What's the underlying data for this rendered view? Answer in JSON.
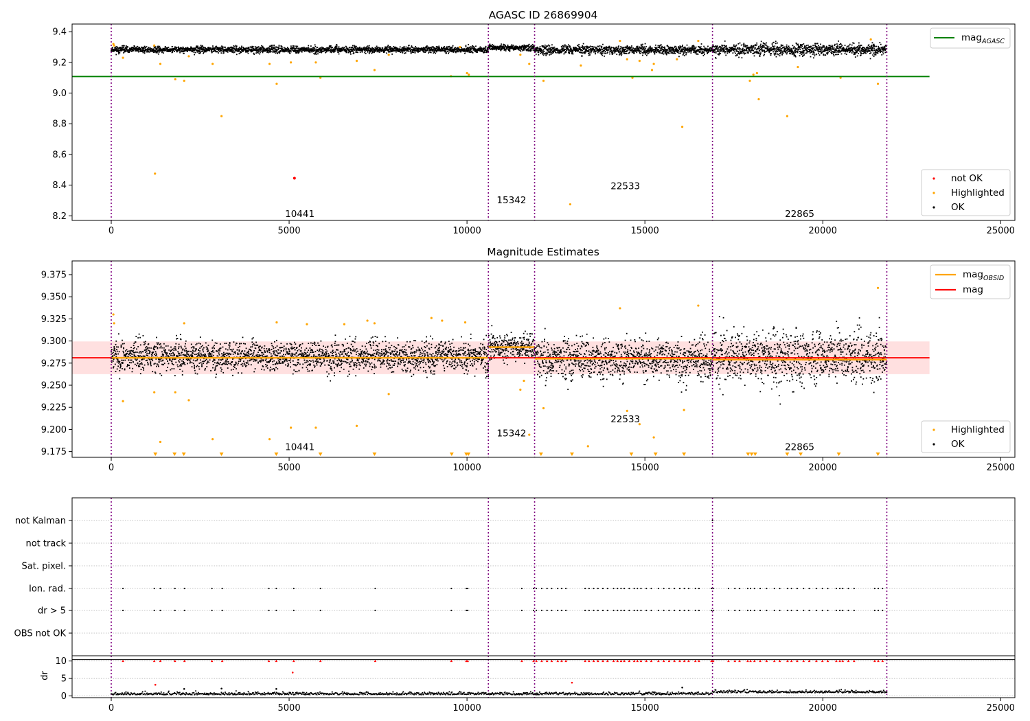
{
  "chart_data": [
    {
      "type": "scatter",
      "title": "AGASC ID 26869904",
      "xlim": [
        -1100,
        25400
      ],
      "ylim": [
        8.17,
        9.45
      ],
      "xticks": [
        0,
        5000,
        10000,
        15000,
        20000,
        25000
      ],
      "xtick_labels": [
        "0",
        "5000",
        "10000",
        "15000",
        "20000",
        "25000"
      ],
      "yticks": [
        8.2,
        8.4,
        8.6,
        8.8,
        9.0,
        9.2,
        9.4
      ],
      "ytick_labels": [
        "8.2",
        "8.4",
        "8.6",
        "8.8",
        "9.0",
        "9.2",
        "9.4"
      ],
      "legend_upper": {
        "placement": "top-right",
        "entries": [
          {
            "label": "mag",
            "sub": "AGASC",
            "color": "#008000"
          }
        ]
      },
      "legend_lower": {
        "placement": "bottom-right",
        "entries": [
          {
            "label": "not OK",
            "color": "#ff0000"
          },
          {
            "label": "Highlighted",
            "color": "#ffa500"
          },
          {
            "label": "OK",
            "color": "#000000"
          }
        ]
      },
      "mag_agasc": {
        "value": 9.108,
        "x": [
          -1100,
          23000
        ]
      },
      "obs_boundaries": [
        0,
        10600,
        11900,
        16900,
        21800
      ],
      "obs_labels": [
        {
          "text": "10441",
          "x": 5300,
          "y": 8.215
        },
        {
          "text": "15342",
          "x": 11250,
          "y": 8.305
        },
        {
          "text": "22533",
          "x": 14450,
          "y": 8.395
        },
        {
          "text": "22865",
          "x": 19350,
          "y": 8.215
        }
      ],
      "ok_band": [
        {
          "x0": 0,
          "x1": 10600,
          "center": 9.283,
          "spread": 0.022
        },
        {
          "x0": 10600,
          "x1": 11900,
          "center": 9.295,
          "spread": 0.02
        },
        {
          "x0": 11900,
          "x1": 16900,
          "center": 9.281,
          "spread": 0.03
        },
        {
          "x0": 16900,
          "x1": 21800,
          "center": 9.283,
          "spread": 0.04
        }
      ],
      "highlighted": [
        [
          60,
          9.32
        ],
        [
          80,
          9.31
        ],
        [
          330,
          9.23
        ],
        [
          1210,
          9.31
        ],
        [
          1230,
          8.475
        ],
        [
          1380,
          9.19
        ],
        [
          1800,
          9.09
        ],
        [
          2050,
          9.08
        ],
        [
          2180,
          9.24
        ],
        [
          2850,
          9.19
        ],
        [
          3100,
          8.85
        ],
        [
          4450,
          9.19
        ],
        [
          4650,
          9.06
        ],
        [
          5050,
          9.2
        ],
        [
          5750,
          9.2
        ],
        [
          5880,
          9.1
        ],
        [
          6900,
          9.21
        ],
        [
          7400,
          9.15
        ],
        [
          7800,
          9.25
        ],
        [
          9550,
          9.11
        ],
        [
          9800,
          9.3
        ],
        [
          10000,
          9.13
        ],
        [
          10050,
          9.12
        ],
        [
          11500,
          9.25
        ],
        [
          11750,
          9.19
        ],
        [
          12150,
          9.08
        ],
        [
          12900,
          8.275
        ],
        [
          13200,
          9.18
        ],
        [
          14300,
          9.34
        ],
        [
          14500,
          9.22
        ],
        [
          14650,
          9.1
        ],
        [
          14850,
          9.21
        ],
        [
          15200,
          9.15
        ],
        [
          15250,
          9.19
        ],
        [
          15900,
          9.22
        ],
        [
          16050,
          8.78
        ],
        [
          16500,
          9.34
        ],
        [
          17950,
          9.08
        ],
        [
          18050,
          9.12
        ],
        [
          18150,
          9.13
        ],
        [
          18200,
          8.96
        ],
        [
          19000,
          8.85
        ],
        [
          19300,
          9.17
        ],
        [
          20500,
          9.1
        ],
        [
          21350,
          9.35
        ],
        [
          21550,
          9.06
        ]
      ],
      "not_ok": [
        [
          5150,
          8.445
        ]
      ]
    },
    {
      "type": "scatter",
      "title": "Magnitude Estimates",
      "xlim": [
        -1100,
        25400
      ],
      "ylim": [
        9.1685,
        9.3905
      ],
      "xticks": [
        0,
        5000,
        10000,
        15000,
        20000,
        25000
      ],
      "xtick_labels": [
        "0",
        "5000",
        "10000",
        "15000",
        "20000",
        "25000"
      ],
      "yticks": [
        9.175,
        9.2,
        9.225,
        9.25,
        9.275,
        9.3,
        9.325,
        9.35,
        9.375
      ],
      "ytick_labels": [
        "9.175",
        "9.200",
        "9.225",
        "9.250",
        "9.275",
        "9.300",
        "9.325",
        "9.350",
        "9.375"
      ],
      "legend_upper": {
        "placement": "top-right",
        "entries": [
          {
            "label": "mag",
            "sub": "OBSID",
            "color": "#ffa500"
          },
          {
            "label": "mag",
            "color": "#ff0000"
          }
        ]
      },
      "legend_lower": {
        "placement": "bottom-right",
        "entries": [
          {
            "label": "Highlighted",
            "color": "#ffa500"
          },
          {
            "label": "OK",
            "color": "#000000"
          }
        ]
      },
      "mag": {
        "value": 9.281,
        "band": [
          9.2625,
          9.2995
        ],
        "x": [
          -1100,
          23000
        ]
      },
      "mag_obsid": [
        {
          "x0": 0,
          "x1": 10600,
          "value": 9.281
        },
        {
          "x0": 10600,
          "x1": 11900,
          "value": 9.293
        },
        {
          "x0": 11900,
          "x1": 16900,
          "value": 9.28
        },
        {
          "x0": 16900,
          "x1": 21800,
          "value": 9.279
        }
      ],
      "obs_boundaries": [
        0,
        10600,
        11900,
        16900,
        21800
      ],
      "obs_labels": [
        {
          "text": "10441",
          "x": 5300,
          "y": 9.1805
        },
        {
          "text": "15342",
          "x": 11250,
          "y": 9.196
        },
        {
          "text": "22533",
          "x": 14450,
          "y": 9.212
        },
        {
          "text": "22865",
          "x": 19350,
          "y": 9.1805
        }
      ],
      "ok_band": [
        {
          "x0": 0,
          "x1": 10600,
          "center": 9.283,
          "spread": 0.018
        },
        {
          "x0": 10600,
          "x1": 11900,
          "center": 9.294,
          "spread": 0.016
        },
        {
          "x0": 11900,
          "x1": 16900,
          "center": 9.279,
          "spread": 0.024
        },
        {
          "x0": 16900,
          "x1": 21800,
          "center": 9.282,
          "spread": 0.032
        }
      ],
      "highlighted": [
        [
          60,
          9.33
        ],
        [
          80,
          9.32
        ],
        [
          330,
          9.232
        ],
        [
          1210,
          9.242
        ],
        [
          1380,
          9.186
        ],
        [
          1800,
          9.242
        ],
        [
          2050,
          9.32
        ],
        [
          2180,
          9.233
        ],
        [
          2850,
          9.189
        ],
        [
          4450,
          9.189
        ],
        [
          4650,
          9.321
        ],
        [
          5050,
          9.202
        ],
        [
          5500,
          9.319
        ],
        [
          5750,
          9.202
        ],
        [
          6550,
          9.319
        ],
        [
          6900,
          9.204
        ],
        [
          7200,
          9.323
        ],
        [
          7400,
          9.32
        ],
        [
          7800,
          9.24
        ],
        [
          9000,
          9.326
        ],
        [
          9300,
          9.323
        ],
        [
          9950,
          9.321
        ],
        [
          11500,
          9.245
        ],
        [
          11600,
          9.255
        ],
        [
          11750,
          9.194
        ],
        [
          12150,
          9.224
        ],
        [
          13400,
          9.181
        ],
        [
          14300,
          9.337
        ],
        [
          14500,
          9.221
        ],
        [
          14850,
          9.206
        ],
        [
          15250,
          9.191
        ],
        [
          16100,
          9.222
        ],
        [
          16500,
          9.34
        ],
        [
          21550,
          9.36
        ]
      ],
      "below_markers": [
        1240,
        1780,
        2040,
        3100,
        4640,
        5880,
        7400,
        9570,
        9980,
        10040,
        12080,
        12950,
        14620,
        15300,
        16100,
        17900,
        18000,
        18100,
        19000,
        19380,
        20450,
        21550
      ]
    },
    {
      "type": "scatter",
      "flags_panel": {
        "ylabels": [
          "not Kalman",
          "not track",
          "Sat. pixel.",
          "Ion. rad.",
          "dr > 5",
          "OBS not OK"
        ],
        "obs_boundaries": [
          0,
          10600,
          11900,
          16900,
          21800
        ],
        "not_kalman": [
          16900
        ],
        "ion_rad": [
          330,
          1210,
          1380,
          1790,
          2060,
          2830,
          3120,
          4430,
          4640,
          5130,
          5880,
          7420,
          9560,
          9980,
          10020,
          11540,
          11870,
          11950,
          12100,
          12250,
          12380,
          12550,
          12660,
          12780,
          13320,
          13430,
          13560,
          13680,
          13820,
          13950,
          14120,
          14230,
          14330,
          14420,
          14560,
          14700,
          14790,
          14890,
          15040,
          15180,
          15380,
          15530,
          15680,
          15830,
          15980,
          16110,
          16230,
          16420,
          16520,
          16870,
          16920,
          17350,
          17530,
          17660,
          17890,
          17970,
          18080,
          18240,
          18420,
          18640,
          18790,
          19010,
          19120,
          19280,
          19460,
          19620,
          19820,
          19990,
          20140,
          20380,
          20480,
          20560,
          20720,
          20880,
          21460,
          21560,
          21680
        ]
      },
      "dr_panel": {
        "ylabel": "dr",
        "ylim": [
          -0.5,
          11.5
        ],
        "yticks": [
          0,
          5,
          10
        ],
        "ytick_labels": [
          "0",
          "5",
          "10"
        ],
        "xlim": [
          -1100,
          25400
        ],
        "xticks": [
          0,
          5000,
          10000,
          15000,
          20000,
          25000
        ],
        "xtick_labels": [
          "0",
          "5000",
          "10000",
          "15000",
          "20000",
          "25000"
        ],
        "cutoff_line": 10.4,
        "outliers": [
          [
            1240,
            3.2,
            "#ff0000"
          ],
          [
            5100,
            6.7,
            "#ff0000"
          ],
          [
            12950,
            3.8,
            "#ff0000"
          ],
          [
            2050,
            2.0,
            "#000000"
          ],
          [
            3100,
            2.1,
            "#000000"
          ],
          [
            4640,
            2.0,
            "#000000"
          ],
          [
            16050,
            2.4,
            "#000000"
          ]
        ]
      }
    }
  ]
}
